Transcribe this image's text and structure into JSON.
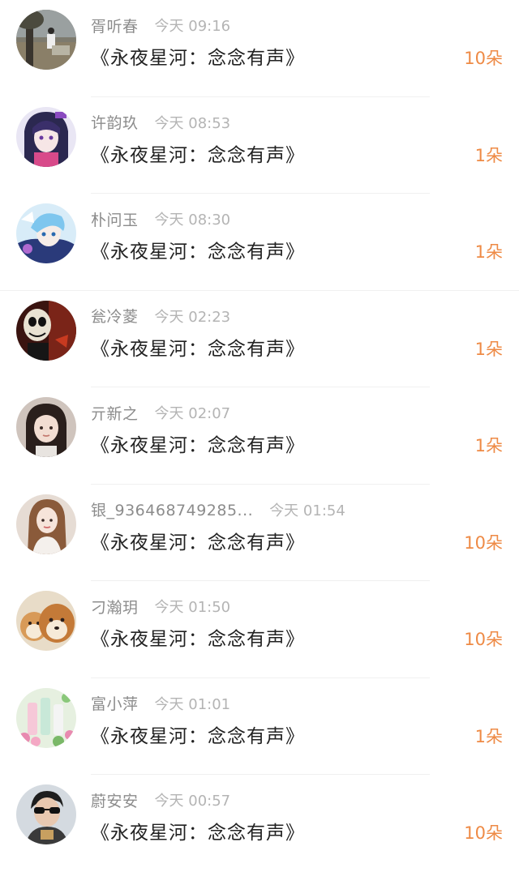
{
  "records": [
    {
      "username": "胥听春",
      "time": "今天 09:16",
      "title": "《永夜星河：念念有声》",
      "amount": "10朵",
      "avatar_icon": "avatar-photo-tree-outdoor"
    },
    {
      "username": "许韵玖",
      "time": "今天 08:53",
      "title": "《永夜星河：念念有声》",
      "amount": "1朵",
      "avatar_icon": "avatar-anime-girl-dark"
    },
    {
      "username": "朴问玉",
      "time": "今天 08:30",
      "title": "《永夜星河：念念有声》",
      "amount": "1朵",
      "avatar_icon": "avatar-anime-boy-blue"
    },
    {
      "username": "瓮冷菱",
      "time": "今天 02:23",
      "title": "《永夜星河：念念有声》",
      "amount": "1朵",
      "avatar_icon": "avatar-skull-character"
    },
    {
      "username": "亓新之",
      "time": "今天 02:07",
      "title": "《永夜星河：念念有声》",
      "amount": "1朵",
      "avatar_icon": "avatar-girl-portrait"
    },
    {
      "username": "银_936468749285...",
      "time": "今天 01:54",
      "title": "《永夜星河：念念有声》",
      "amount": "10朵",
      "avatar_icon": "avatar-woman-long-hair"
    },
    {
      "username": "刁瀚玥",
      "time": "今天 01:50",
      "title": "《永夜星河：念念有声》",
      "amount": "10朵",
      "avatar_icon": "avatar-shiba-dogs"
    },
    {
      "username": "富小萍",
      "time": "今天 01:01",
      "title": "《永夜星河：念念有声》",
      "amount": "1朵",
      "avatar_icon": "avatar-bottles-flowers"
    },
    {
      "username": "蔚安安",
      "time": "今天 00:57",
      "title": "《永夜星河：念念有声》",
      "amount": "10朵",
      "avatar_icon": "avatar-man-sunglasses"
    }
  ],
  "colors": {
    "username": "#8c8c8c",
    "time": "#b4b4b4",
    "title": "#222222",
    "amount": "#ee8a45",
    "divider": "#f0f0f0"
  }
}
